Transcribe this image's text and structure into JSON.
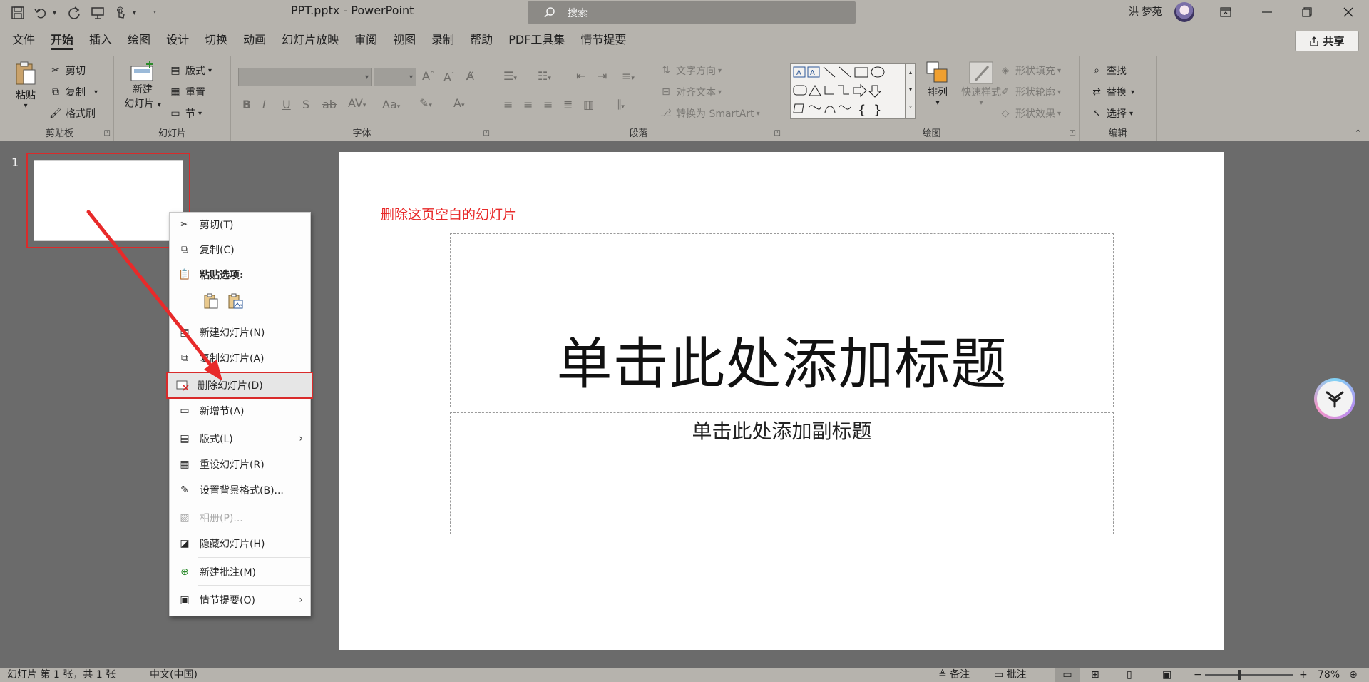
{
  "app": {
    "doc_title": "PPT.pptx  -  PowerPoint",
    "search_placeholder": "搜索",
    "user_name": "洪 梦苑",
    "share_label": "共享"
  },
  "tabs": [
    "文件",
    "开始",
    "插入",
    "绘图",
    "设计",
    "切换",
    "动画",
    "幻灯片放映",
    "审阅",
    "视图",
    "录制",
    "帮助",
    "PDF工具集",
    "情节提要"
  ],
  "active_tab": "开始",
  "ribbon": {
    "clipboard": {
      "label": "剪贴板",
      "paste": "粘贴",
      "cut": "剪切",
      "copy": "复制",
      "format_painter": "格式刷"
    },
    "slides": {
      "label": "幻灯片",
      "new_slide_1": "新建",
      "new_slide_2": "幻灯片",
      "layout": "版式",
      "reset": "重置",
      "section": "节"
    },
    "font": {
      "label": "字体"
    },
    "paragraph": {
      "label": "段落",
      "text_direction": "文字方向",
      "align_text": "对齐文本",
      "convert_smartart": "转换为 SmartArt"
    },
    "drawing": {
      "label": "绘图",
      "arrange": "排列",
      "quick_styles": "快速样式",
      "shape_fill": "形状填充",
      "shape_outline": "形状轮廓",
      "shape_effects": "形状效果"
    },
    "editing": {
      "label": "编辑",
      "find": "查找",
      "replace": "替换",
      "select": "选择"
    }
  },
  "thumbnails": {
    "slide_number": "1"
  },
  "slide": {
    "annotation": "删除这页空白的幻灯片",
    "title_placeholder": "单击此处添加标题",
    "subtitle_placeholder": "单击此处添加副标题"
  },
  "context_menu": {
    "cut": "剪切(T)",
    "copy": "复制(C)",
    "paste_options": "粘贴选项:",
    "new_slide": "新建幻灯片(N)",
    "duplicate_slide": "复制幻灯片(A)",
    "delete_slide": "删除幻灯片(D)",
    "add_section": "新增节(A)",
    "layout": "版式(L)",
    "reset_slide": "重设幻灯片(R)",
    "format_background": "设置背景格式(B)...",
    "photo_album": "相册(P)...",
    "hide_slide": "隐藏幻灯片(H)",
    "new_comment": "新建批注(M)",
    "storyboard": "情节提要(O)"
  },
  "statusbar": {
    "slide_info": "幻灯片 第 1 张，共 1 张",
    "language": "中文(中国)",
    "notes": "备注",
    "comments": "批注",
    "zoom": "78%"
  },
  "colors": {
    "accent_red": "#d92b2b",
    "annotation_red": "#e82a2a",
    "ribbon_bg": "#b6b3ad"
  }
}
